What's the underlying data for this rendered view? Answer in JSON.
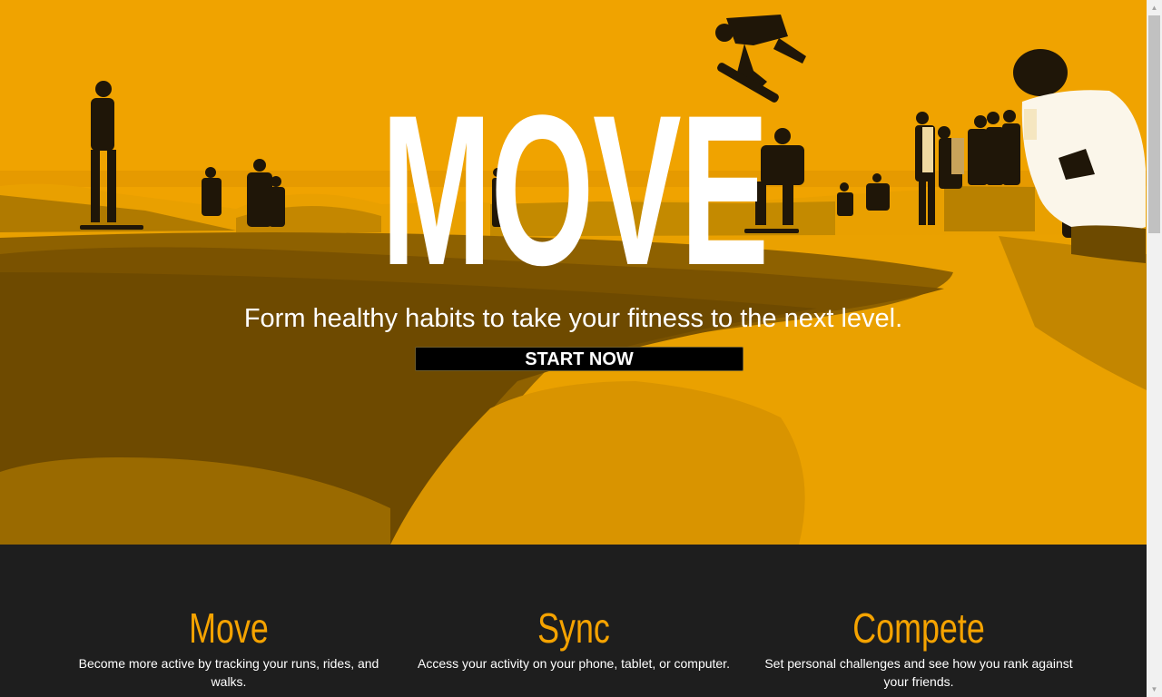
{
  "hero": {
    "title": "MOVE",
    "subtitle": "Form healthy habits to take your fitness to the next level.",
    "cta_label": "START NOW"
  },
  "features": [
    {
      "title": "Move",
      "text": "Become more active by tracking your runs, rides, and walks."
    },
    {
      "title": "Sync",
      "text": "Access your activity on your phone, tablet, or computer."
    },
    {
      "title": "Compete",
      "text": "Set personal challenges and see how you rank against your friends."
    }
  ],
  "colors": {
    "accent": "#f5a300",
    "hero_tint": "#f0a200",
    "dark_bg": "#1e1e1e",
    "button_bg": "#000000"
  },
  "scrollbar": {
    "up_icon": "scroll-up-arrow-icon",
    "down_icon": "scroll-down-arrow-icon"
  }
}
